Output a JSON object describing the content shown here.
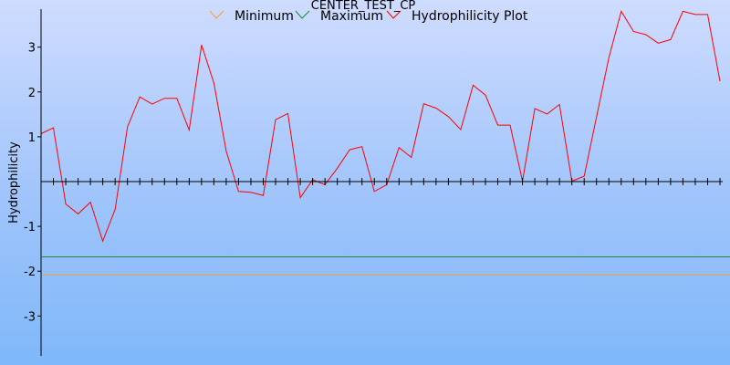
{
  "chart_data": {
    "type": "line",
    "title": "CENTER_TEST_CP",
    "xlabel": "",
    "ylabel": "Hydrophilicity",
    "ylim": [
      -3.85,
      3.85
    ],
    "yticks": [
      -3,
      -2,
      -1,
      1,
      2,
      3
    ],
    "ytick_labels": [
      "-3",
      "-2",
      "-1",
      "1",
      "2",
      "3"
    ],
    "xlim": [
      1,
      56
    ],
    "grid": false,
    "legend_position": "top",
    "x": [
      1,
      2,
      3,
      4,
      5,
      6,
      7,
      8,
      9,
      10,
      11,
      12,
      13,
      14,
      15,
      16,
      17,
      18,
      19,
      20,
      21,
      22,
      23,
      24,
      25,
      26,
      27,
      28,
      29,
      30,
      31,
      32,
      33,
      34,
      35,
      36,
      37,
      38,
      39,
      40,
      41,
      42,
      43,
      44,
      45,
      46,
      47,
      48,
      49,
      50,
      51,
      52,
      53,
      54,
      55,
      56
    ],
    "series": [
      {
        "name": "Minimum",
        "color": "#f0a030",
        "constant": -2.08
      },
      {
        "name": "Maximum",
        "color": "#1a8a3a",
        "constant": -1.68
      },
      {
        "name": "Hydrophilicity Plot",
        "color": "#ff0000",
        "values": [
          1.07,
          1.2,
          -0.5,
          -0.72,
          -0.46,
          -1.33,
          -0.62,
          1.22,
          1.89,
          1.73,
          1.86,
          1.86,
          1.15,
          3.05,
          2.2,
          0.68,
          -0.22,
          -0.24,
          -0.31,
          1.38,
          1.52,
          -0.36,
          0.04,
          -0.07,
          0.3,
          0.71,
          0.78,
          -0.22,
          -0.07,
          0.76,
          0.54,
          1.74,
          1.64,
          1.45,
          1.16,
          2.15,
          1.93,
          1.26,
          1.26,
          0.01,
          1.63,
          1.51,
          1.72,
          0.01,
          0.12,
          1.44,
          2.77,
          3.8,
          3.35,
          3.28,
          3.09,
          3.17,
          3.8,
          3.73,
          3.73,
          2.24
        ]
      }
    ]
  }
}
